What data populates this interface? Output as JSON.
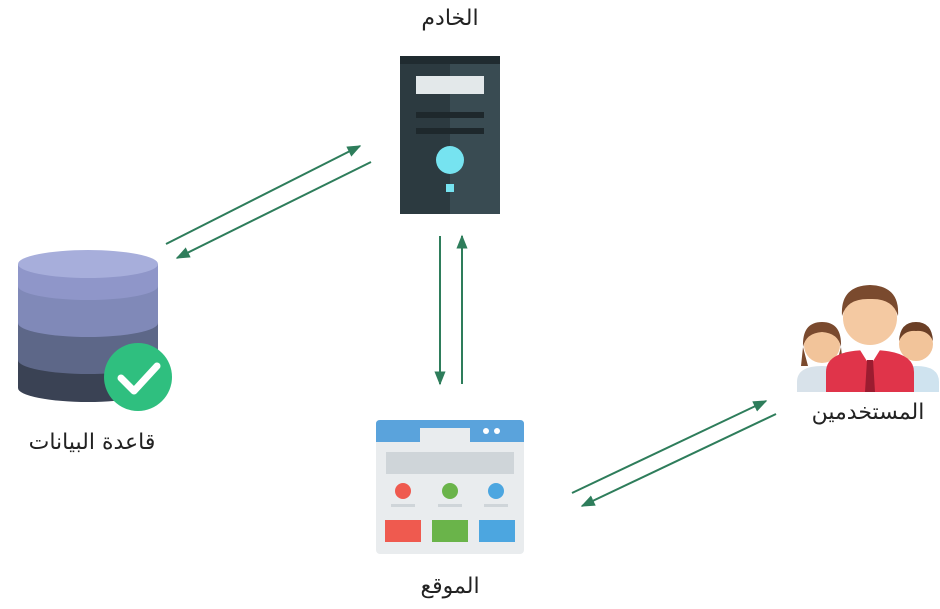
{
  "nodes": {
    "server": {
      "label": "الخادم",
      "icon": "server-icon"
    },
    "database": {
      "label": "قاعدة البيانات",
      "icon": "database-icon"
    },
    "users": {
      "label": "المستخدمين",
      "icon": "users-icon"
    },
    "website": {
      "label": "الموقع",
      "icon": "website-icon"
    }
  },
  "edges": [
    {
      "from": "database",
      "to": "server"
    },
    {
      "from": "server",
      "to": "database"
    },
    {
      "from": "server",
      "to": "website"
    },
    {
      "from": "website",
      "to": "server"
    },
    {
      "from": "website",
      "to": "users"
    },
    {
      "from": "users",
      "to": "website"
    }
  ],
  "colors": {
    "arrow": "#2e7d5b",
    "server_body": "#34444a",
    "server_light": "#76e3f0",
    "db_top": "#8f96c9",
    "db_mid": "#5d6788",
    "db_bottom": "#3a4254",
    "check_badge": "#2fbf7f",
    "browser_bar": "#5aa3dc",
    "tile_red": "#ef5a4f",
    "tile_green": "#6ab44a",
    "tile_blue": "#4ca6e0",
    "shirt_red": "#e0344a"
  }
}
